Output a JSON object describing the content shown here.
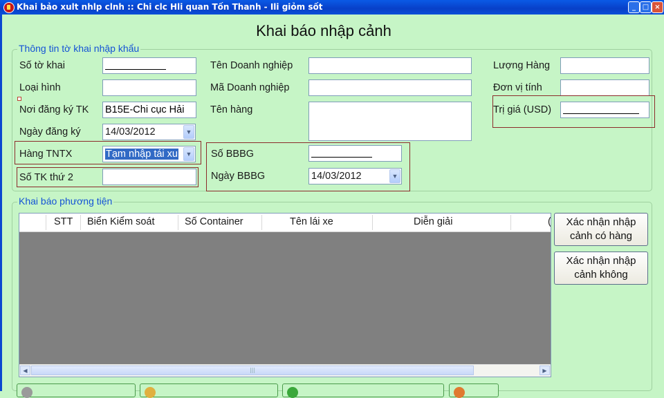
{
  "window": {
    "title": "Khai bảo xult nhlp clnh :: Chi clc Hli quan Tốn Thanh - Ili giỏm sốt",
    "buttons": [
      "_",
      "□",
      "×"
    ]
  },
  "form": {
    "title": "Khai báo nhập cảnh",
    "group_import": "Thông tin tờ khai nhập khẩu",
    "group_vehicle": "Khai báo phương tiện"
  },
  "fields": {
    "so_to_khai": {
      "label": "Số tờ khai"
    },
    "loai_hinh": {
      "label": "Loại hình",
      "value": ""
    },
    "noi_dang_ky": {
      "label": "Nơi đăng ký TK",
      "value": "B15E-Chi cục Hải"
    },
    "ngay_dang_ky": {
      "label": "Ngày đăng ký",
      "value": "14/03/2012"
    },
    "hang_tntx": {
      "label": "Hàng TNTX",
      "value": "Tạm nhập tái xu"
    },
    "so_tk_thu_2": {
      "label": "Số TK thứ 2",
      "value": ""
    },
    "ten_dn": {
      "label": "Tên Doanh nghiệp",
      "value": ""
    },
    "ma_dn": {
      "label": "Mã Doanh nghiệp",
      "value": ""
    },
    "ten_hang": {
      "label": "Tên hàng",
      "value": ""
    },
    "so_bbbg": {
      "label": "Số BBBG"
    },
    "ngay_bbbg": {
      "label": "Ngày BBBG",
      "value": "14/03/2012"
    },
    "luong_hang": {
      "label": "Lượng Hàng",
      "value": ""
    },
    "don_vi_tinh": {
      "label": "Đơn vị tính",
      "value": ""
    },
    "tri_gia": {
      "label": "Trị giá (USD)"
    }
  },
  "grid": {
    "columns": [
      "STT",
      "Biển Kiểm soát",
      "Số Container",
      "Tên lái xe",
      "Diễn giải",
      "("
    ]
  },
  "actions": {
    "confirm_with_goods": "Xác nhận nhập cảnh có hàng",
    "confirm_empty": "Xác nhận nhập cảnh không"
  },
  "colors": {
    "background": "#c6f5c6",
    "titlebar": "#0a4fd8",
    "legend": "#1453d6",
    "highlight_border": "#8b2a2a"
  }
}
